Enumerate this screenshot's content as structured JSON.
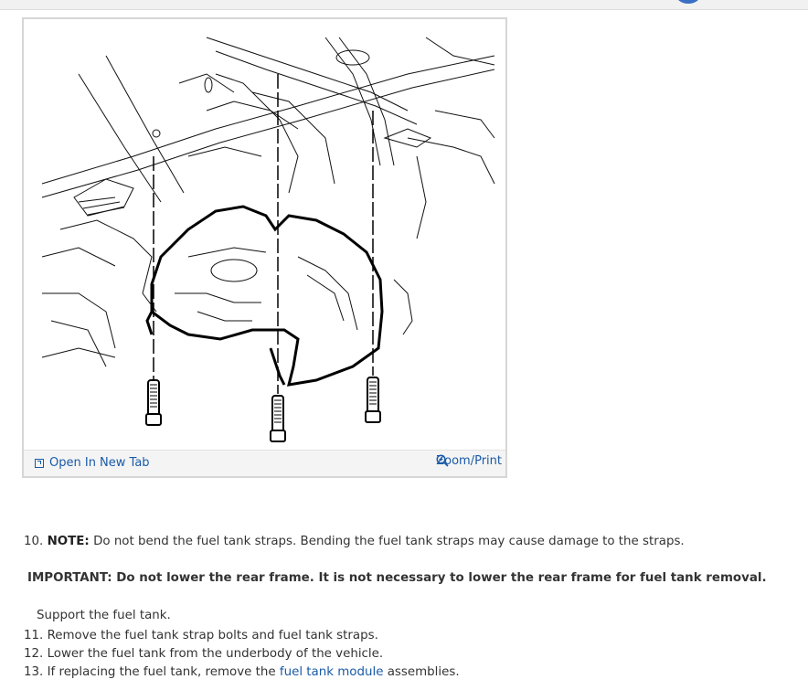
{
  "figure": {
    "open_tab_label": "Open In New Tab",
    "zoom_label": "Zoom/Print"
  },
  "step10": {
    "number": "10.",
    "note_label": "NOTE:",
    "text": "Do not bend the fuel tank straps. Bending the fuel tank straps may cause damage to the straps."
  },
  "important": "IMPORTANT: Do not lower the rear frame. It is not necessary to lower the rear frame for fuel tank removal.",
  "support": "Support the fuel tank.",
  "step11": {
    "number": "11.",
    "text": "Remove the fuel tank strap bolts and fuel tank straps."
  },
  "step12": {
    "number": "12.",
    "text": "Lower the fuel tank from the underbody of the vehicle."
  },
  "step13": {
    "number": "13.",
    "text_before": "If replacing the fuel tank, remove the",
    "link": "fuel tank module",
    "text_after": "assemblies."
  },
  "colors": {
    "link": "#1a5aa8",
    "text": "#333333"
  },
  "icons": [
    "open-in-new-tab-icon",
    "zoom-icon"
  ]
}
